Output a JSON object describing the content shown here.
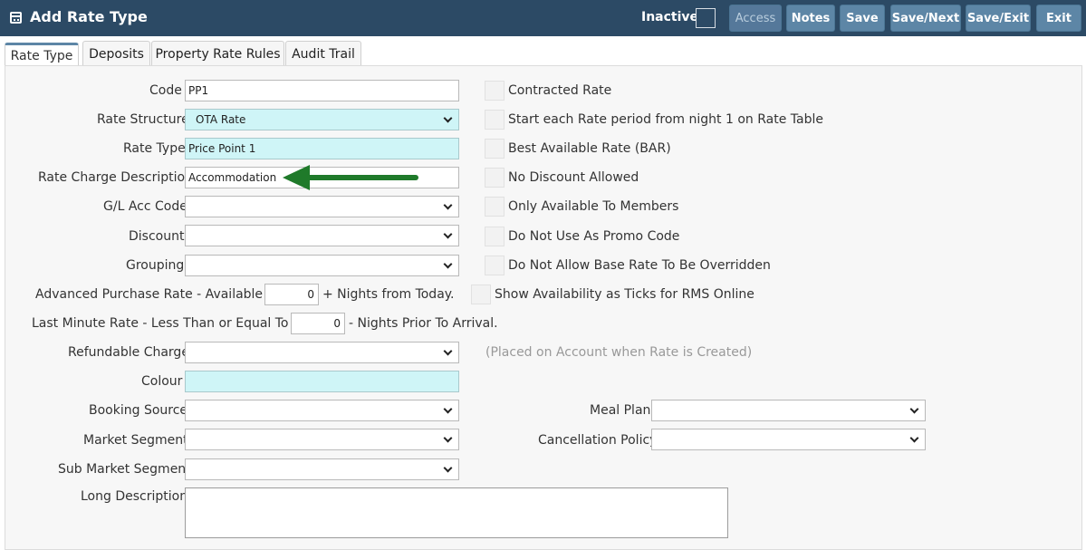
{
  "window": {
    "title": "Add Rate Type",
    "icon": "calendar-icon"
  },
  "toolbar": {
    "inactive_label": "Inactive:",
    "access": "Access",
    "notes": "Notes",
    "save": "Save",
    "save_next": "Save/Next",
    "save_exit": "Save/Exit",
    "exit": "Exit"
  },
  "tabs": [
    {
      "label": "Rate Type",
      "active": true
    },
    {
      "label": "Deposits"
    },
    {
      "label": "Property Rate Rules"
    },
    {
      "label": "Audit Trail"
    }
  ],
  "form": {
    "code": {
      "label": "Code",
      "value": "PP1"
    },
    "rate_structure": {
      "label": "Rate Structure",
      "value": "OTA Rate"
    },
    "rate_type": {
      "label": "Rate Type",
      "value": "Price Point 1"
    },
    "rate_charge_description": {
      "label": "Rate Charge Description",
      "value": "Accommodation"
    },
    "gl_acc_code": {
      "label": "G/L Acc Code",
      "value": ""
    },
    "discount": {
      "label": "Discount",
      "value": ""
    },
    "grouping": {
      "label": "Grouping",
      "value": ""
    },
    "advanced_purchase": {
      "label": "Advanced Purchase Rate - Available",
      "value": "0",
      "suffix": "+ Nights from Today."
    },
    "last_minute": {
      "label": "Last Minute Rate - Less Than or Equal To",
      "value": "0",
      "suffix": "- Nights Prior To Arrival."
    },
    "refundable_charge": {
      "label": "Refundable Charge",
      "value": "",
      "hint": "(Placed on Account when Rate is Created)"
    },
    "colour": {
      "label": "Colour",
      "value": ""
    },
    "booking_source": {
      "label": "Booking Source",
      "value": ""
    },
    "market_segment": {
      "label": "Market Segment",
      "value": ""
    },
    "sub_market_segment": {
      "label": "Sub Market Segment",
      "value": ""
    },
    "long_description": {
      "label": "Long Description",
      "value": ""
    },
    "meal_plan": {
      "label": "Meal Plan",
      "value": ""
    },
    "cancellation_policy": {
      "label": "Cancellation Policy",
      "value": ""
    }
  },
  "checkboxes": [
    {
      "label": "Contracted Rate",
      "checked": false
    },
    {
      "label": "Start each Rate period from night 1 on Rate Table",
      "checked": false
    },
    {
      "label": "Best Available Rate (BAR)",
      "checked": false
    },
    {
      "label": "No Discount Allowed",
      "checked": false
    },
    {
      "label": "Only Available To Members",
      "checked": false
    },
    {
      "label": "Do Not Use As Promo Code",
      "checked": false
    },
    {
      "label": "Do Not Allow Base Rate To Be Overridden",
      "checked": false
    },
    {
      "label": "Show Availability as Ticks for RMS Online",
      "checked": false
    }
  ],
  "colors": {
    "titlebar": "#2c4a65",
    "button": "#5d86a6",
    "cyan_field": "#cff5f7",
    "arrow": "#1f7a2a"
  }
}
